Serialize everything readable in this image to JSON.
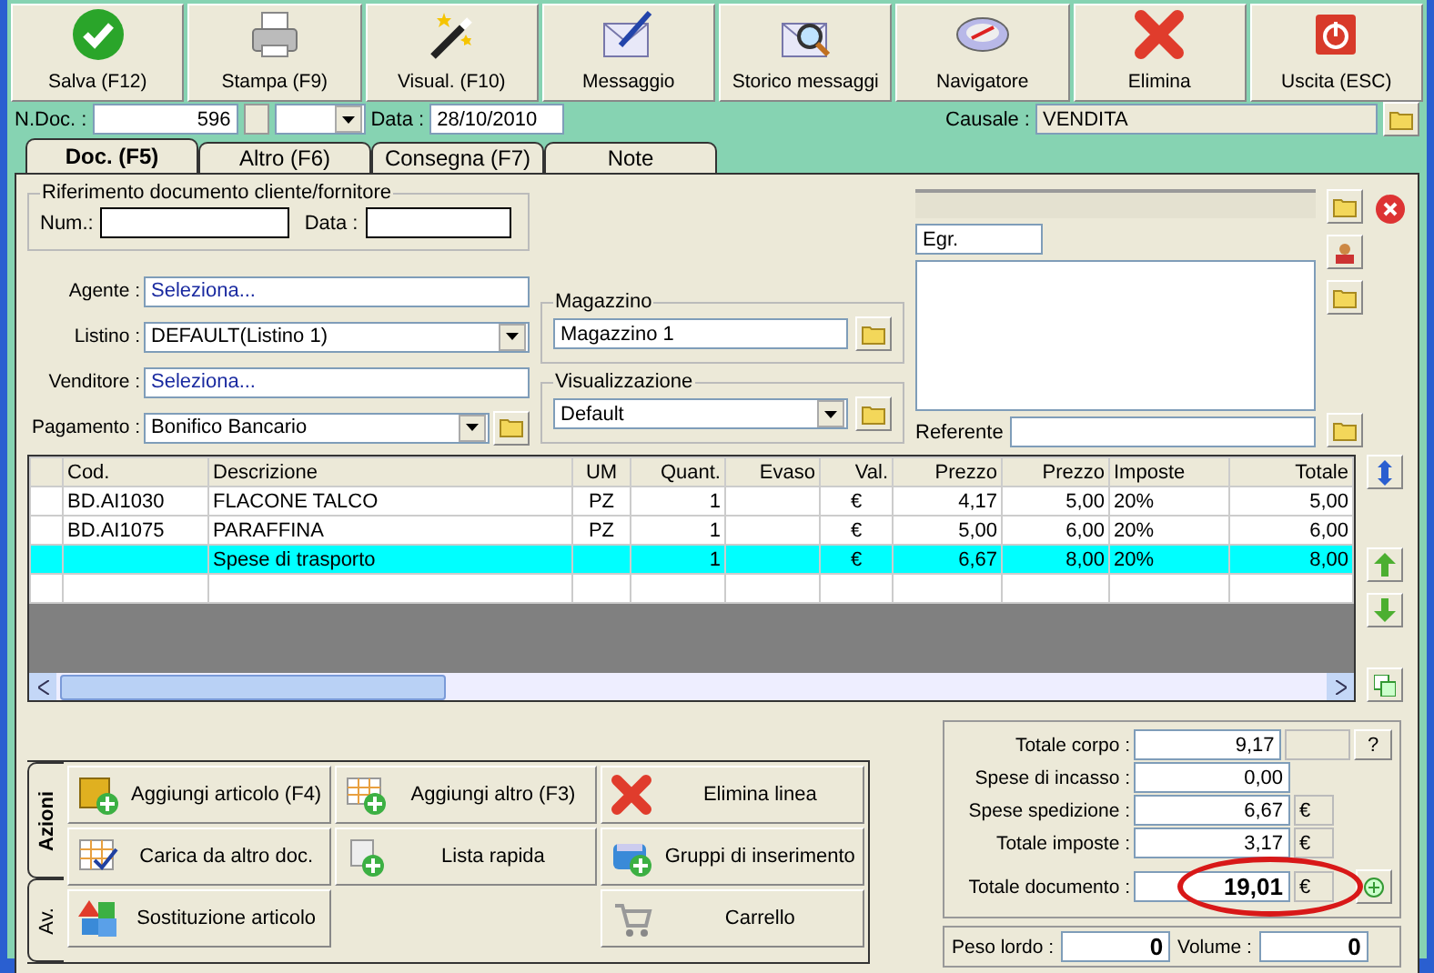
{
  "toolbar": [
    {
      "label": "Salva (F12)"
    },
    {
      "label": "Stampa (F9)"
    },
    {
      "label": "Visual. (F10)"
    },
    {
      "label": "Messaggio"
    },
    {
      "label": "Storico messaggi"
    },
    {
      "label": "Navigatore"
    },
    {
      "label": "Elimina"
    },
    {
      "label": "Uscita (ESC)"
    }
  ],
  "header": {
    "ndoc_label": "N.Doc. :",
    "ndoc_value": "596",
    "data_label": "Data :",
    "data_value": "28/10/2010",
    "causale_label": "Causale :",
    "causale_value": "VENDITA"
  },
  "tabs": [
    {
      "label": "Doc. (F5)",
      "selected": true
    },
    {
      "label": "Altro (F6)",
      "selected": false
    },
    {
      "label": "Consegna (F7)",
      "selected": false
    },
    {
      "label": "Note",
      "selected": false
    }
  ],
  "riferimento": {
    "legend": "Riferimento documento cliente/fornitore",
    "num_label": "Num.:",
    "data_label": "Data :"
  },
  "fields": [
    {
      "label": "Agente :",
      "value": "Seleziona...",
      "kind": "link"
    },
    {
      "label": "Listino :",
      "value": "DEFAULT(Listino 1)",
      "kind": "combo"
    },
    {
      "label": "Venditore :",
      "value": "Seleziona...",
      "kind": "link"
    },
    {
      "label": "Pagamento :",
      "value": "Bonifico Bancario",
      "kind": "combo-folder"
    }
  ],
  "magazzino": {
    "legend": "Magazzino",
    "value": "Magazzino 1"
  },
  "visualizzazione": {
    "legend": "Visualizzazione",
    "value": "Default"
  },
  "customer": {
    "title_value": "Egr.",
    "referente_label": "Referente"
  },
  "table": {
    "columns": [
      "Cod.",
      "Descrizione",
      "UM",
      "Quant.",
      "Evaso",
      "Val.",
      "Prezzo",
      "Prezzo",
      "Imposte",
      "Totale"
    ],
    "rows": [
      {
        "selected": false,
        "cells": [
          "BD.AI1030",
          "FLACONE TALCO",
          "PZ",
          "1",
          "",
          "€",
          "4,17",
          "5,00",
          "20%",
          "5,00"
        ]
      },
      {
        "selected": false,
        "cells": [
          "BD.AI1075",
          "PARAFFINA",
          "PZ",
          "1",
          "",
          "€",
          "5,00",
          "6,00",
          "20%",
          "6,00"
        ]
      },
      {
        "selected": true,
        "cells": [
          "",
          "Spese di trasporto",
          "",
          "1",
          "",
          "€",
          "6,67",
          "8,00",
          "20%",
          "8,00"
        ]
      }
    ]
  },
  "side_tabs": [
    {
      "label": "Azioni",
      "selected": true
    },
    {
      "label": "Av.",
      "selected": false
    }
  ],
  "actions": [
    {
      "label": "Aggiungi articolo (F4)"
    },
    {
      "label": "Aggiungi altro (F3)"
    },
    {
      "label": "Elimina linea"
    },
    {
      "label": "Carica da altro doc."
    },
    {
      "label": "Lista rapida"
    },
    {
      "label": "Gruppi di inserimento"
    },
    {
      "label": "Sostituzione articolo"
    },
    {
      "label": "Carrello"
    }
  ],
  "totals": [
    {
      "label": "Totale corpo :",
      "value": "9,17",
      "kind": "help",
      "suffix": "?"
    },
    {
      "label": "Spese di incasso :",
      "value": "0,00",
      "kind": "plain"
    },
    {
      "label": "Spese spedizione :",
      "value": "6,67",
      "kind": "currency",
      "suffix": "€"
    },
    {
      "label": "Totale imposte :",
      "value": "3,17",
      "kind": "currency",
      "suffix": "€"
    },
    {
      "label": "Totale documento :",
      "value": "19,01",
      "kind": "total",
      "suffix": "€"
    }
  ],
  "weights": [
    {
      "label": "Peso lordo :",
      "value": "0"
    },
    {
      "label": "Volume :",
      "value": "0"
    }
  ]
}
